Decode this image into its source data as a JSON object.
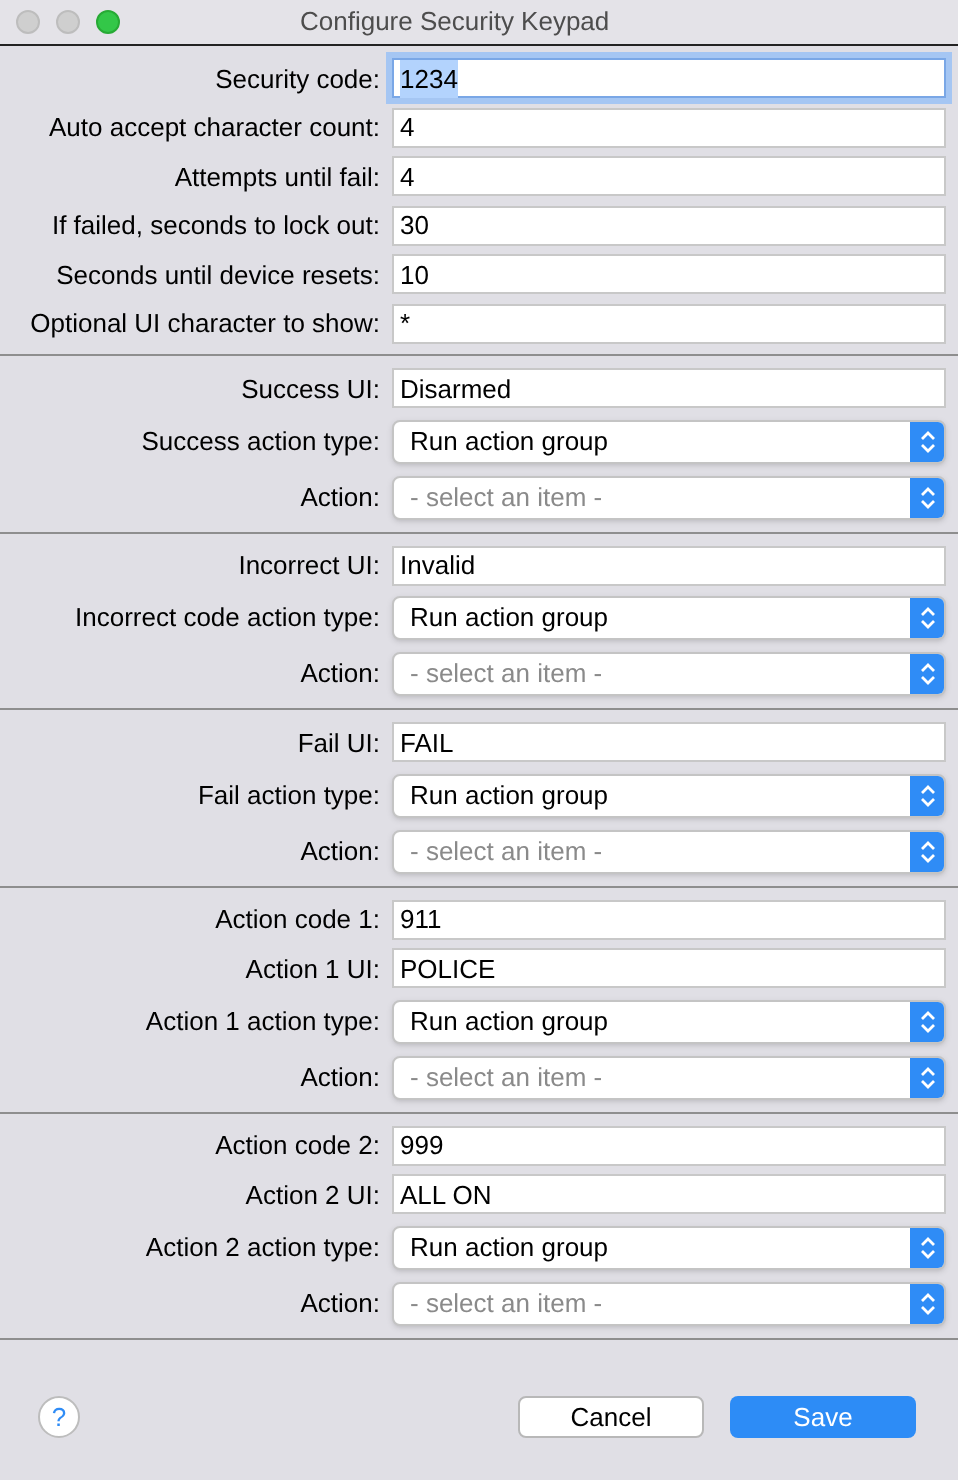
{
  "window": {
    "title": "Configure Security Keypad"
  },
  "sections": [
    {
      "fields": [
        {
          "kind": "text",
          "label": "Security code:",
          "value": "1234",
          "focused": true
        },
        {
          "kind": "text",
          "label": "Auto accept character count:",
          "value": "4",
          "focused": false
        },
        {
          "kind": "text",
          "label": "Attempts until fail:",
          "value": "4",
          "focused": false
        },
        {
          "kind": "text",
          "label": "If failed, seconds to lock out:",
          "value": "30",
          "focused": false
        },
        {
          "kind": "text",
          "label": "Seconds until device resets:",
          "value": "10",
          "focused": false
        },
        {
          "kind": "text",
          "label": "Optional UI character to show:",
          "value": "*",
          "focused": false
        }
      ]
    },
    {
      "fields": [
        {
          "kind": "text",
          "label": "Success UI:",
          "value": "Disarmed",
          "focused": false
        },
        {
          "kind": "select",
          "label": "Success action type:",
          "value": "Run action group"
        },
        {
          "kind": "select",
          "label": "Action:",
          "placeholder": "- select an item -"
        }
      ]
    },
    {
      "fields": [
        {
          "kind": "text",
          "label": "Incorrect UI:",
          "value": "Invalid",
          "focused": false
        },
        {
          "kind": "select",
          "label": "Incorrect code action type:",
          "value": "Run action group"
        },
        {
          "kind": "select",
          "label": "Action:",
          "placeholder": "- select an item -"
        }
      ]
    },
    {
      "fields": [
        {
          "kind": "text",
          "label": "Fail UI:",
          "value": "FAIL",
          "focused": false
        },
        {
          "kind": "select",
          "label": "Fail action type:",
          "value": "Run action group"
        },
        {
          "kind": "select",
          "label": "Action:",
          "placeholder": "- select an item -"
        }
      ]
    },
    {
      "fields": [
        {
          "kind": "text",
          "label": "Action code 1:",
          "value": "911",
          "focused": false
        },
        {
          "kind": "text",
          "label": "Action 1 UI:",
          "value": "POLICE",
          "focused": false
        },
        {
          "kind": "select",
          "label": "Action 1 action type:",
          "value": "Run action group"
        },
        {
          "kind": "select",
          "label": "Action:",
          "placeholder": "- select an item -"
        }
      ]
    },
    {
      "fields": [
        {
          "kind": "text",
          "label": "Action code 2:",
          "value": "999",
          "focused": false
        },
        {
          "kind": "text",
          "label": "Action 2 UI:",
          "value": "ALL ON",
          "focused": false
        },
        {
          "kind": "select",
          "label": "Action 2 action type:",
          "value": "Run action group"
        },
        {
          "kind": "select",
          "label": "Action:",
          "placeholder": "- select an item -"
        }
      ]
    }
  ],
  "footer": {
    "help": "?",
    "buttons": [
      {
        "label": "Cancel",
        "kind": "normal"
      },
      {
        "label": "Save",
        "kind": "default"
      }
    ]
  }
}
